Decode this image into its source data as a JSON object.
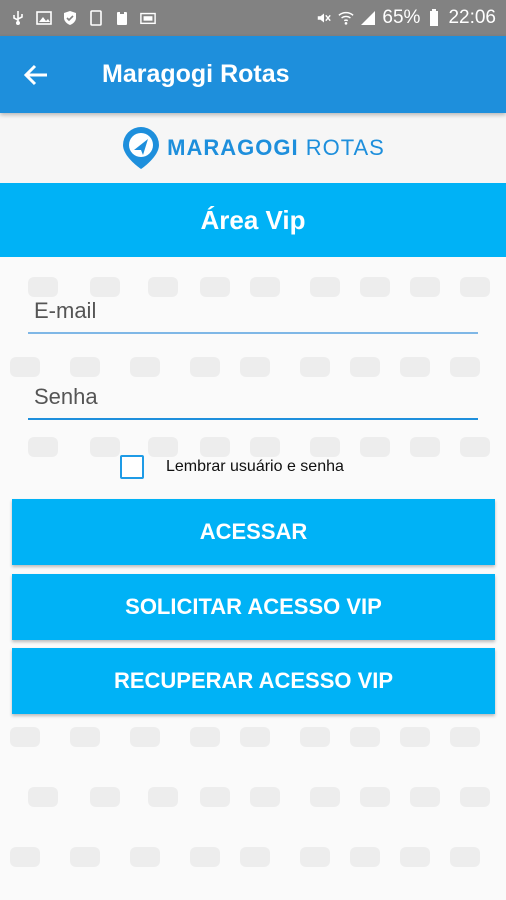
{
  "status_bar": {
    "battery": "65%",
    "time": "22:06",
    "icons": [
      "usb-icon",
      "image-icon",
      "shield-icon",
      "tablet-icon",
      "clipboard-icon",
      "gallery-icon",
      "mute-icon",
      "wifi-icon",
      "signal-icon",
      "battery-icon"
    ]
  },
  "app_bar": {
    "title": "Maragogi Rotas",
    "back_icon": "arrow-left-icon"
  },
  "logo": {
    "strong": "MARAGOGI",
    "light": "ROTAS",
    "icon": "location-arrow-icon"
  },
  "section": {
    "title": "Área Vip"
  },
  "form": {
    "email_placeholder": "E-mail",
    "password_placeholder": "Senha",
    "remember_label": "Lembrar usuário e senha"
  },
  "buttons": {
    "login": "ACESSAR",
    "request": "SOLICITAR ACESSO VIP",
    "recover": "RECUPERAR ACESSO VIP"
  },
  "colors": {
    "app_bar": "#1e8fdc",
    "primary": "#00b2f6",
    "status_bar": "#828282"
  }
}
